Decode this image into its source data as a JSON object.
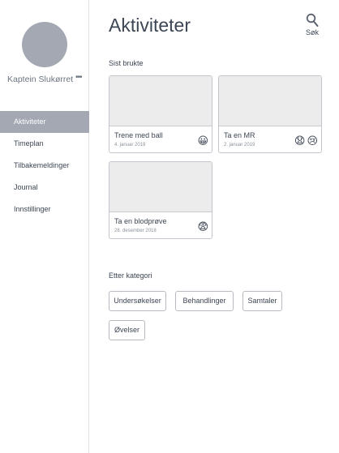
{
  "profile": {
    "name": "Kaptein Slukørret",
    "more_label": "•••"
  },
  "nav": {
    "items": [
      {
        "label": "Aktiviteter",
        "active": true
      },
      {
        "label": "Timeplan"
      },
      {
        "label": "Tilbakemeldinger"
      },
      {
        "label": "Journal"
      },
      {
        "label": "Innstillinger"
      }
    ]
  },
  "header": {
    "title": "Aktiviteter",
    "search_label": "Søk",
    "search_icon": "search-icon"
  },
  "recent": {
    "label": "Sist brukte",
    "cards": [
      {
        "title": "Trene med ball",
        "date": "4. januar 2019",
        "emojis": [
          "😀"
        ]
      },
      {
        "title": "Ta en MR",
        "date": "2. januar 2019",
        "emojis": [
          "😧",
          "😢"
        ]
      },
      {
        "title": "Ta en blodprøve",
        "date": "28. desember 2018",
        "emojis": [
          "😨"
        ]
      }
    ]
  },
  "categories": {
    "label": "Etter kategori",
    "items": [
      "Undersøkelser",
      "Behandlinger",
      "Samtaler",
      "Øvelser"
    ]
  },
  "colors": {
    "accent": "#a3a8b3",
    "text": "#3d4654",
    "thumb": "#ececec"
  }
}
